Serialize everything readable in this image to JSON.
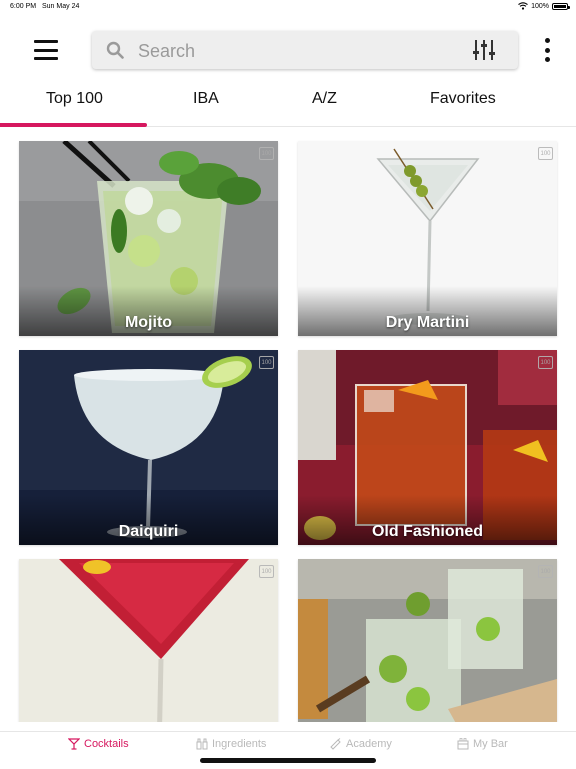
{
  "status_bar": {
    "time": "6:00 PM",
    "date": "Sun May 24",
    "battery": "100%"
  },
  "header": {
    "menu_icon": "hamburger-icon",
    "search": {
      "placeholder": "Search",
      "value": ""
    },
    "filter_icon": "sliders-icon",
    "more_icon": "vertical-dots-icon"
  },
  "tabs": [
    {
      "label": "Top 100",
      "active": true
    },
    {
      "label": "IBA",
      "active": false
    },
    {
      "label": "A/Z",
      "active": false
    },
    {
      "label": "Favorites",
      "active": false
    }
  ],
  "cocktails": [
    {
      "name": "Mojito",
      "badge": "100"
    },
    {
      "name": "Dry Martini",
      "badge": "100"
    },
    {
      "name": "Daiquiri",
      "badge": "100"
    },
    {
      "name": "Old Fashioned",
      "badge": "100"
    },
    {
      "name": "",
      "badge": "100"
    },
    {
      "name": "",
      "badge": "100"
    }
  ],
  "bottom_nav": [
    {
      "label": "Cocktails",
      "icon": "cocktail-glass-icon",
      "active": true
    },
    {
      "label": "Ingredients",
      "icon": "bottles-icon",
      "active": false
    },
    {
      "label": "Academy",
      "icon": "shaker-icon",
      "active": false
    },
    {
      "label": "My Bar",
      "icon": "bar-icon",
      "active": false
    }
  ],
  "colors": {
    "accent": "#d6185f",
    "inactive": "#b9b9b9"
  }
}
